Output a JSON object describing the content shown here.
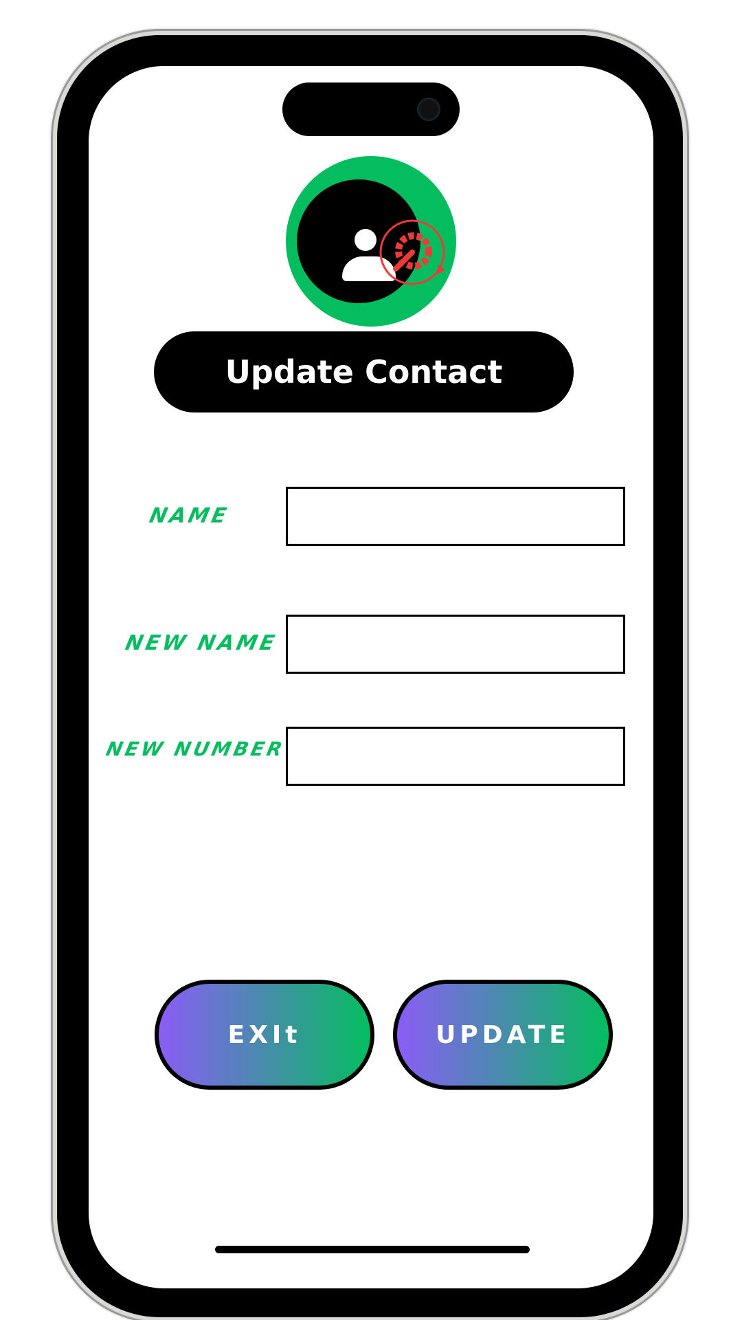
{
  "header": {
    "title": "Update Contact",
    "icon": "contact-settings-icon"
  },
  "form": {
    "fields": [
      {
        "label": "NAME",
        "value": ""
      },
      {
        "label": "NEW NAME",
        "value": ""
      },
      {
        "label": "NEW NUMBER",
        "value": ""
      }
    ]
  },
  "actions": {
    "exit_label": "EXIt",
    "update_label": "UPDATE"
  },
  "colors": {
    "accent": "#03bd5f",
    "gradient_start": "#8b5cf6",
    "gear": "#f03a3a"
  }
}
